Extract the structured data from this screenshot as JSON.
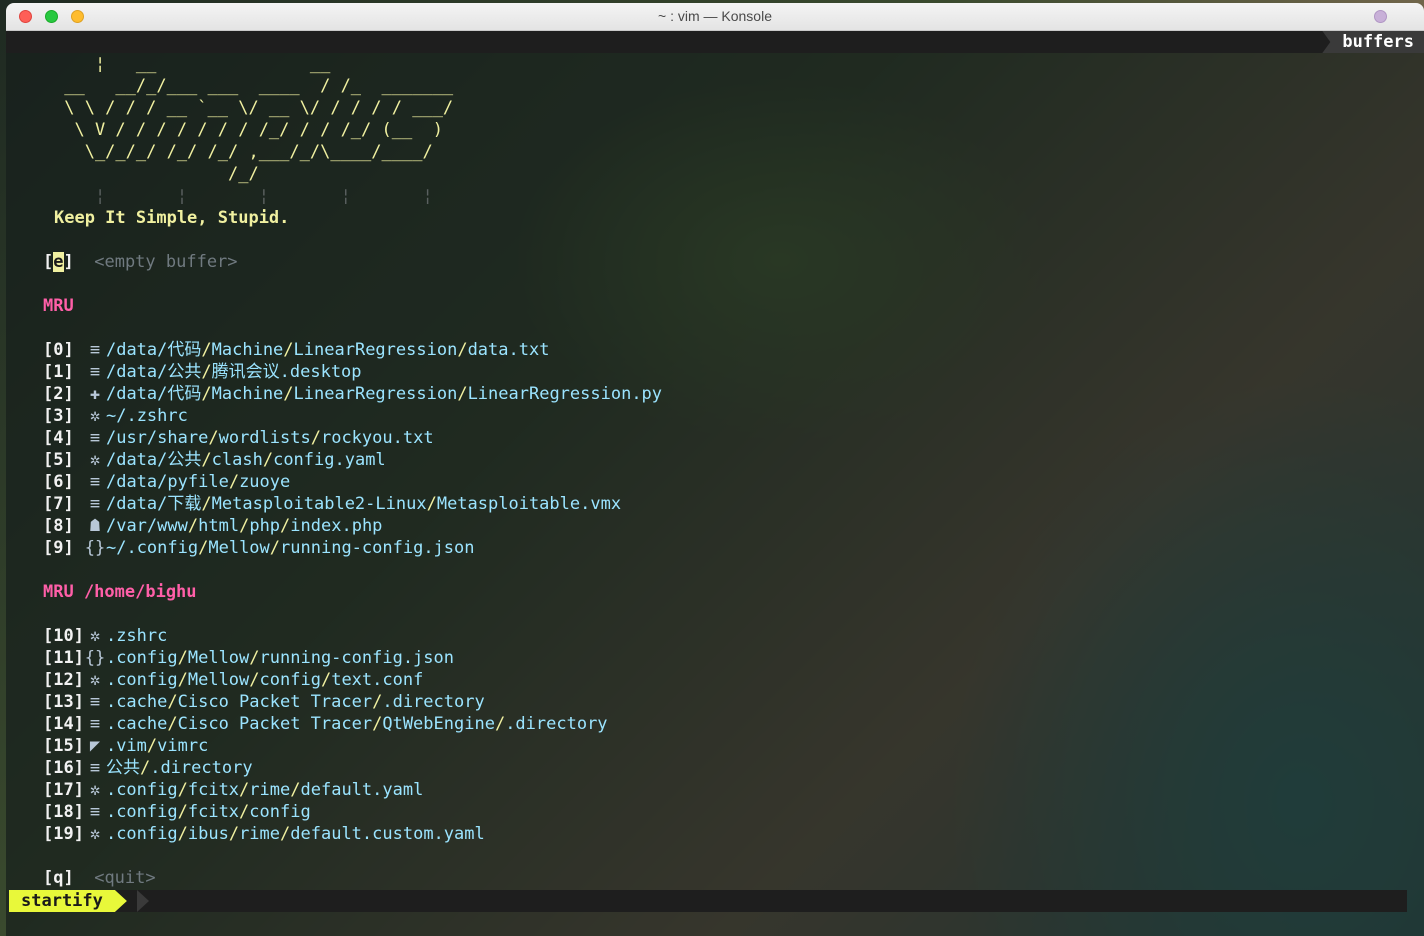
{
  "window": {
    "title": "~ : vim — Konsole"
  },
  "tabline": {
    "buffers_label": "buffers"
  },
  "banner": {
    "ascii": [
      "    ¦   __               __",
      " __   __/_/___ ___  ____  / /_  _______",
      " \\ \\ / / / __ `__ \\/ __ \\/ / / / / ___/",
      "  \\ V / / / / / / / /_/ / / /_/ (__  )",
      "   \\_/_/_/ /_/ /_/ ,___/_/\\____/____/",
      "                 /_/"
    ],
    "guides": "    ¦       ¦       ¦       ¦       ¦",
    "slogan": "Keep It Simple, Stupid."
  },
  "empty_buffer": {
    "key_left": "[",
    "key": "e",
    "key_right": "]",
    "label": "<empty buffer>"
  },
  "mru_header": "MRU",
  "mru": [
    {
      "key": "[0]",
      "icon": "≡",
      "icon_name": "text-file-icon",
      "segments": [
        "/data/",
        "代码",
        "/",
        "Machine",
        "/",
        "LinearRegression",
        "/",
        "data.txt"
      ]
    },
    {
      "key": "[1]",
      "icon": "≡",
      "icon_name": "text-file-icon",
      "segments": [
        "/data/",
        "公共",
        "/",
        "腾讯会议",
        ".desktop"
      ]
    },
    {
      "key": "[2]",
      "icon": "✚",
      "icon_name": "python-file-icon",
      "segments": [
        "/data/",
        "代码",
        "/",
        "Machine",
        "/",
        "LinearRegression",
        "/",
        "LinearRegression.py"
      ]
    },
    {
      "key": "[3]",
      "icon": "✲",
      "icon_name": "gear-icon",
      "segments": [
        "~/",
        ".zshrc"
      ]
    },
    {
      "key": "[4]",
      "icon": "≡",
      "icon_name": "text-file-icon",
      "segments": [
        "/usr/",
        "share",
        "/",
        "wordlists",
        "/",
        "rockyou.txt"
      ]
    },
    {
      "key": "[5]",
      "icon": "✲",
      "icon_name": "gear-icon",
      "segments": [
        "/data/",
        "公共",
        "/",
        "clash",
        "/",
        "config.yaml"
      ]
    },
    {
      "key": "[6]",
      "icon": "≡",
      "icon_name": "text-file-icon",
      "segments": [
        "/data/",
        "pyfile",
        "/",
        "zuoye"
      ]
    },
    {
      "key": "[7]",
      "icon": "≡",
      "icon_name": "text-file-icon",
      "segments": [
        "/data/",
        "下载",
        "/",
        "Metasploitable2-Linux",
        "/",
        "Metasploitable.vmx"
      ]
    },
    {
      "key": "[8]",
      "icon": "☗",
      "icon_name": "php-file-icon",
      "segments": [
        "/var/",
        "www",
        "/",
        "html",
        "/",
        "php",
        "/",
        "index.php"
      ]
    },
    {
      "key": "[9]",
      "icon": "{}",
      "icon_name": "json-file-icon",
      "segments": [
        "~/",
        ".config",
        "/",
        "Mellow",
        "/",
        "running-config.json"
      ]
    }
  ],
  "mru_home_header": "MRU /home/bighu",
  "mru_home": [
    {
      "key": "[10]",
      "icon": "✲",
      "icon_name": "gear-icon",
      "segments": [
        ".zshrc"
      ]
    },
    {
      "key": "[11]",
      "icon": "{}",
      "icon_name": "json-file-icon",
      "segments": [
        ".config",
        "/",
        "Mellow",
        "/",
        "running-config.json"
      ]
    },
    {
      "key": "[12]",
      "icon": "✲",
      "icon_name": "gear-icon",
      "segments": [
        ".config",
        "/",
        "Mellow",
        "/",
        "config",
        "/",
        "text.conf"
      ]
    },
    {
      "key": "[13]",
      "icon": "≡",
      "icon_name": "text-file-icon",
      "segments": [
        ".cache",
        "/",
        "Cisco Packet Tracer",
        "/",
        ".directory"
      ]
    },
    {
      "key": "[14]",
      "icon": "≡",
      "icon_name": "text-file-icon",
      "segments": [
        ".cache",
        "/",
        "Cisco Packet Tracer",
        "/",
        "QtWebEngine",
        "/",
        ".directory"
      ]
    },
    {
      "key": "[15]",
      "icon": "◤",
      "icon_name": "vim-file-icon",
      "segments": [
        ".vim",
        "/",
        "vimrc"
      ]
    },
    {
      "key": "[16]",
      "icon": "≡",
      "icon_name": "text-file-icon",
      "segments": [
        "公共",
        "/",
        ".directory"
      ]
    },
    {
      "key": "[17]",
      "icon": "✲",
      "icon_name": "gear-icon",
      "segments": [
        ".config",
        "/",
        "fcitx",
        "/",
        "rime",
        "/",
        "default.yaml"
      ]
    },
    {
      "key": "[18]",
      "icon": "≡",
      "icon_name": "text-file-icon",
      "segments": [
        ".config",
        "/",
        "fcitx",
        "/",
        "config"
      ]
    },
    {
      "key": "[19]",
      "icon": "✲",
      "icon_name": "gear-icon",
      "segments": [
        ".config",
        "/",
        "ibus",
        "/",
        "rime",
        "/",
        "default.custom.yaml"
      ]
    }
  ],
  "quit": {
    "key": "[q]",
    "label": "<quit>"
  },
  "statusline": {
    "mode": "startify"
  },
  "colors": {
    "path": "#9be4ff",
    "separator": "#f0f0a0",
    "header": "#ff5fa8",
    "mode_bg": "#e8f83a",
    "muted": "#707a80"
  }
}
